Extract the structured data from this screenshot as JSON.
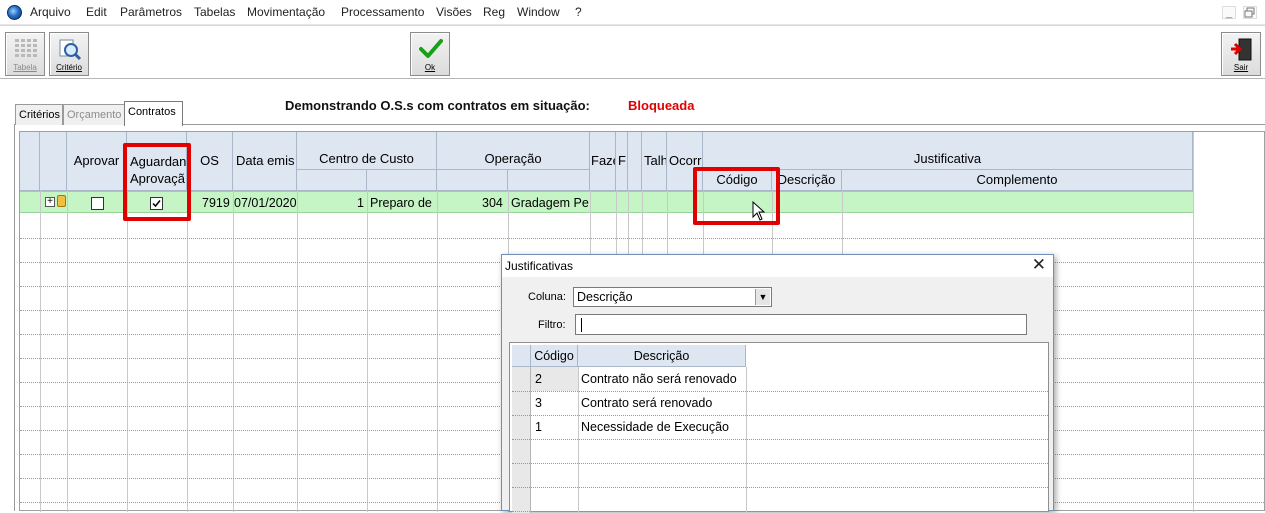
{
  "menu": [
    "Arquivo",
    "Edit",
    "Parâmetros",
    "Tabelas",
    "Movimentação",
    "Processamento",
    "Visões",
    "Reg",
    "Window",
    "?"
  ],
  "window_controls": {
    "minimize": "_",
    "restore": "🗗"
  },
  "toolbar": {
    "tabela_label": "Tabela",
    "criterio_label": "Critério",
    "ok_label": "Ok",
    "sair_label": "Sair"
  },
  "tabs": [
    {
      "label": "Critérios",
      "state": "normal"
    },
    {
      "label": "Orçamento",
      "state": "disabled"
    },
    {
      "label": "Contratos",
      "state": "active"
    }
  ],
  "status": {
    "title": "Demonstrando O.S.s com contratos em situação:",
    "value": "Bloqueada",
    "value_color": "#e00000"
  },
  "grid": {
    "headers": {
      "aprovar": "Aprovar",
      "aguardando_l1": "Aguardand",
      "aguardando_l2": "Aprovaçã",
      "os": "OS",
      "data": "Data emis",
      "centro_custo": "Centro de Custo",
      "operacao": "Operação",
      "fazenda": "Fazen",
      "f": "F",
      "talhao": "Talh",
      "ocorrencia": "Ocorr",
      "justificativa": "Justificativa",
      "codigo": "Código",
      "descricao": "Descrição",
      "complemento": "Complemento"
    },
    "row": {
      "expand_icon": "plus-box-icon",
      "aprovar_checked": false,
      "aguardando_checked": true,
      "os": "7919",
      "data": "07/01/2020",
      "cc_num": "1",
      "cc_desc": "Preparo de",
      "op_num": "304",
      "op_desc": "Gradagem Pe",
      "highlight_color": "#c5f5c5"
    }
  },
  "dialog": {
    "title": "Justificativas",
    "close": "✕",
    "coluna_label": "Coluna:",
    "coluna_value": "Descrição",
    "filtro_label": "Filtro:",
    "filtro_value": "",
    "headers": {
      "codigo": "Código",
      "descricao": "Descrição"
    },
    "rows": [
      {
        "codigo": "2",
        "descricao": "Contrato não será renovado"
      },
      {
        "codigo": "3",
        "descricao": "Contrato será renovado"
      },
      {
        "codigo": "1",
        "descricao": "Necessidade de Execução"
      }
    ]
  }
}
